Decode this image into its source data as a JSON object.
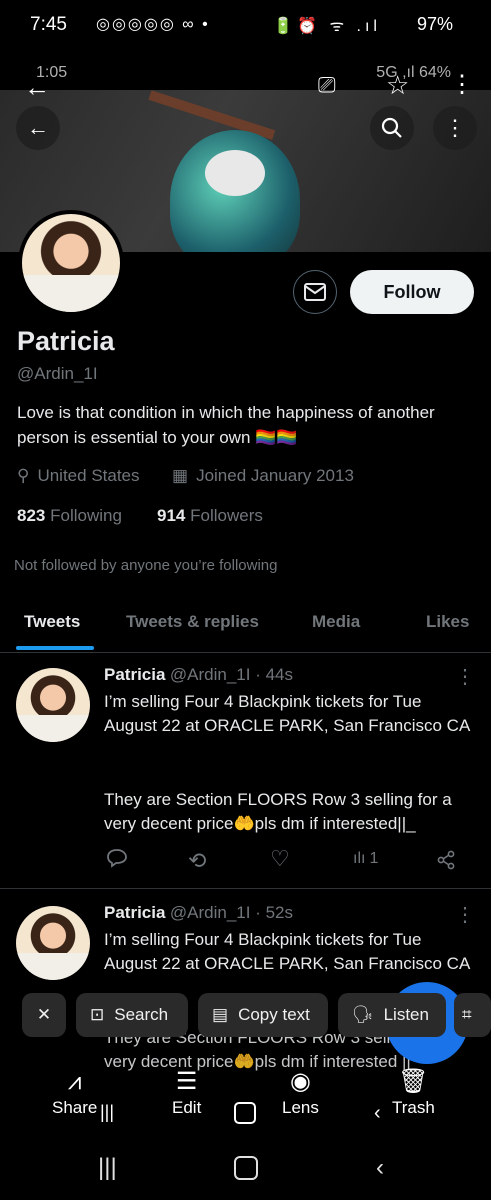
{
  "status": {
    "time": "7:45",
    "left_icons": "◎◎◎◎◎ ∞ •",
    "right_icons": "🔋⏰ ᯤ .ıl",
    "battery": "97%"
  },
  "ghost_status": {
    "time": "1:05",
    "right": "5G ,ıl 64%"
  },
  "profile": {
    "name": "Patricia",
    "handle": "@Ardin_1I",
    "bio": "Love is that condition in which the happiness of another person is essential to your own 🏳️‍🌈🏳️‍🌈",
    "location": "United States",
    "joined": "Joined January 2013",
    "following_count": "823",
    "following_label": "Following",
    "followers_count": "914",
    "followers_label": "Followers",
    "not_followed": "Not followed by anyone you’re following",
    "follow_label": "Follow"
  },
  "tabs": [
    {
      "label": "Tweets"
    },
    {
      "label": "Tweets & replies"
    },
    {
      "label": "Media"
    },
    {
      "label": "Likes"
    }
  ],
  "tweets": [
    {
      "name": "Patricia",
      "handle_time": "@Ardin_1I · 44s",
      "text1": "I’m selling Four 4 Blackpink tickets for Tue August 22 at ORACLE PARK, San Francisco CA",
      "text2": "They are Section FLOORS Row 3 selling for a very decent price🤲pls dm if interested||_",
      "views": "1"
    },
    {
      "name": "Patricia",
      "handle_time": "@Ardin_1I · 52s",
      "text1": "I’m selling Four 4 Blackpink tickets for Tue August 22 at ORACLE PARK, San Francisco CA",
      "text2": "They are Section FLOORS Row 3 selling for a very decent price🤲pls dm if interested ||_"
    }
  ],
  "lens_bar": {
    "search": "Search",
    "copy_text": "Copy text",
    "listen": "Listen"
  },
  "bottom_actions": {
    "share": "Share",
    "edit": "Edit",
    "lens": "Lens",
    "trash": "Trash"
  },
  "colors": {
    "accent": "#1d9bf0",
    "secondary_text": "#71767b",
    "lens_blue": "#1a73e8"
  }
}
